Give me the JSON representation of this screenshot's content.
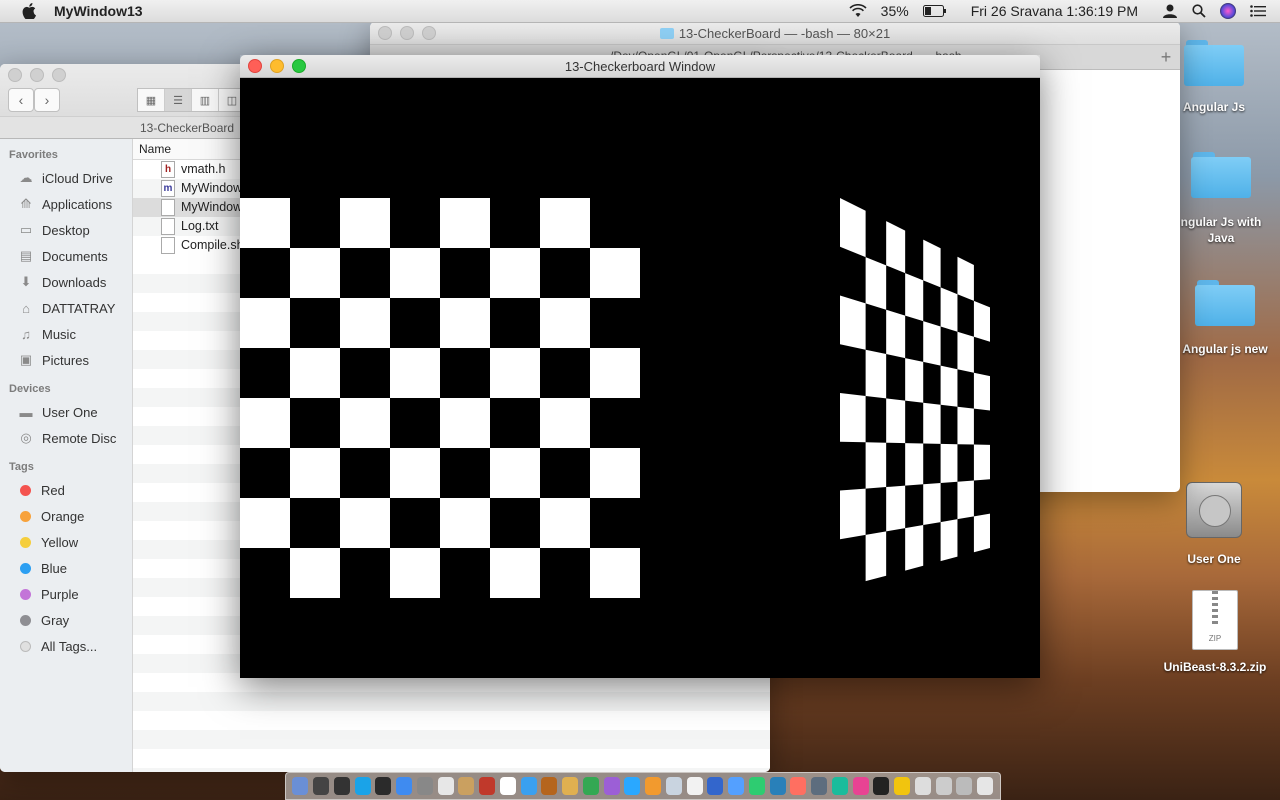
{
  "menubar": {
    "app_name": "MyWindow13",
    "battery": "35%",
    "clock": "Fri 26 Sravana  1:36:19 PM"
  },
  "terminal": {
    "title": "13-CheckerBoard — -bash — 80×21",
    "tab_label": "/Dev/OpenGL/01-OpenGL/Perspective/13-CheckerBoard — -bash"
  },
  "finder": {
    "path": "13-CheckerBoard",
    "sidebar": {
      "favorites_label": "Favorites",
      "favorites": [
        {
          "label": "iCloud Drive",
          "icon": "cloud-icon"
        },
        {
          "label": "Applications",
          "icon": "applications-icon"
        },
        {
          "label": "Desktop",
          "icon": "desktop-icon"
        },
        {
          "label": "Documents",
          "icon": "documents-icon"
        },
        {
          "label": "Downloads",
          "icon": "downloads-icon"
        },
        {
          "label": "DATTATRAY",
          "icon": "home-icon"
        },
        {
          "label": "Music",
          "icon": "music-icon"
        },
        {
          "label": "Pictures",
          "icon": "pictures-icon"
        }
      ],
      "devices_label": "Devices",
      "devices": [
        {
          "label": "User One",
          "icon": "disk-icon"
        },
        {
          "label": "Remote Disc",
          "icon": "disc-icon"
        }
      ],
      "tags_label": "Tags",
      "tags": [
        {
          "label": "Red",
          "color": "#f4534f"
        },
        {
          "label": "Orange",
          "color": "#f7a23c"
        },
        {
          "label": "Yellow",
          "color": "#f5ce3d"
        },
        {
          "label": "Blue",
          "color": "#2c9ff2"
        },
        {
          "label": "Purple",
          "color": "#c374d8"
        },
        {
          "label": "Gray",
          "color": "#8e8e93"
        },
        {
          "label": "All Tags...",
          "color": "#e0e0e0"
        }
      ]
    },
    "column_name": "Name",
    "files": [
      {
        "name": "vmath.h",
        "badge": "h",
        "badge_color": "#a02222"
      },
      {
        "name": "MyWindow",
        "badge": "m",
        "badge_color": "#3a3a9a"
      },
      {
        "name": "MyWindow",
        "badge": "",
        "badge_color": "#555"
      },
      {
        "name": "Log.txt",
        "badge": "",
        "badge_color": "#555"
      },
      {
        "name": "Compile.sh",
        "badge": "",
        "badge_color": "#555"
      }
    ]
  },
  "checkerboard_window": {
    "title": "13-Checkerboard Window"
  },
  "desktop": {
    "icons": [
      {
        "label": "Angular Js"
      },
      {
        "label": "ngular Js with Java"
      },
      {
        "label": "Angular js new"
      },
      {
        "label": "User One"
      },
      {
        "label": "UniBeast-8.3.2.zip"
      }
    ]
  },
  "colors": {
    "close": "#ff5f57",
    "minimize": "#febc2e",
    "zoom": "#28c840"
  }
}
